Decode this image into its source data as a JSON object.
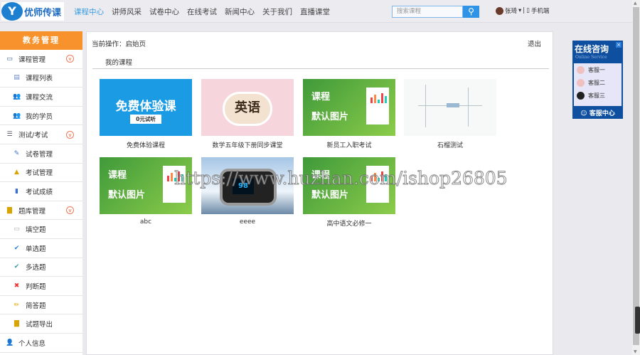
{
  "header": {
    "logo_text": "优师传课",
    "nav": [
      "课程中心",
      "讲师风采",
      "试卷中心",
      "在线考试",
      "新闻中心",
      "关于我们",
      "直播课堂"
    ],
    "active_nav": 0,
    "search_placeholder": "搜索课程",
    "user_name": "张琦",
    "mobile_label": "手机端"
  },
  "sidebar": {
    "title": "教务管理",
    "items": [
      {
        "label": "课程管理",
        "type": "group",
        "icon": "monitor-icon"
      },
      {
        "label": "课程列表",
        "type": "sub",
        "icon": "list-window-icon"
      },
      {
        "label": "课程交流",
        "type": "sub",
        "icon": "users-icon"
      },
      {
        "label": "我的学员",
        "type": "sub",
        "icon": "users-icon"
      },
      {
        "label": "测试/考试",
        "type": "group",
        "icon": "list-icon"
      },
      {
        "label": "试卷管理",
        "type": "sub",
        "icon": "edit-paper-icon"
      },
      {
        "label": "考试管理",
        "type": "sub",
        "icon": "exam-icon"
      },
      {
        "label": "考试成绩",
        "type": "sub",
        "icon": "bar-chart-icon"
      },
      {
        "label": "题库管理",
        "type": "group",
        "icon": "book-icon"
      },
      {
        "label": "填空题",
        "type": "sub",
        "icon": "blank-icon"
      },
      {
        "label": "单选题",
        "type": "sub",
        "icon": "check-icon"
      },
      {
        "label": "多选题",
        "type": "sub",
        "icon": "multi-check-icon"
      },
      {
        "label": "判断题",
        "type": "sub",
        "icon": "true-false-icon"
      },
      {
        "label": "简答题",
        "type": "sub",
        "icon": "pencil-icon"
      },
      {
        "label": "试题导出",
        "type": "sub",
        "icon": "book-icon"
      },
      {
        "label": "个人信息",
        "type": "group",
        "icon": "person-icon"
      }
    ]
  },
  "main": {
    "breadcrumb": "当前操作：启始页",
    "logout": "退出",
    "section_title": "我的课程",
    "courses": [
      {
        "title": "免费体验课程",
        "thumb": "blue",
        "thumb_text": "免费体验课",
        "thumb_button": "0元试听"
      },
      {
        "title": "数学五年级下册同步课堂",
        "thumb": "pink",
        "thumb_text": "英语"
      },
      {
        "title": "新员工入职考试",
        "thumb": "green",
        "thumb_text": "课程",
        "thumb_text2": "默认图片"
      },
      {
        "title": "石榴测试",
        "thumb": "mind"
      },
      {
        "title": "abc",
        "thumb": "green",
        "thumb_text": "课程",
        "thumb_text2": "默认图片"
      },
      {
        "title": "eeee",
        "thumb": "photo",
        "thumb_text": "98"
      },
      {
        "title": "高中语文必修一",
        "thumb": "green",
        "thumb_text": "课程",
        "thumb_text2": "默认图片"
      }
    ]
  },
  "watermark": "https://www.huzhan.com/ishop26805",
  "chat": {
    "title": "在线咨询",
    "subtitle": "Online Service",
    "agents": [
      "客服一",
      "客服二",
      "客服三"
    ],
    "footer": "客服中心"
  }
}
